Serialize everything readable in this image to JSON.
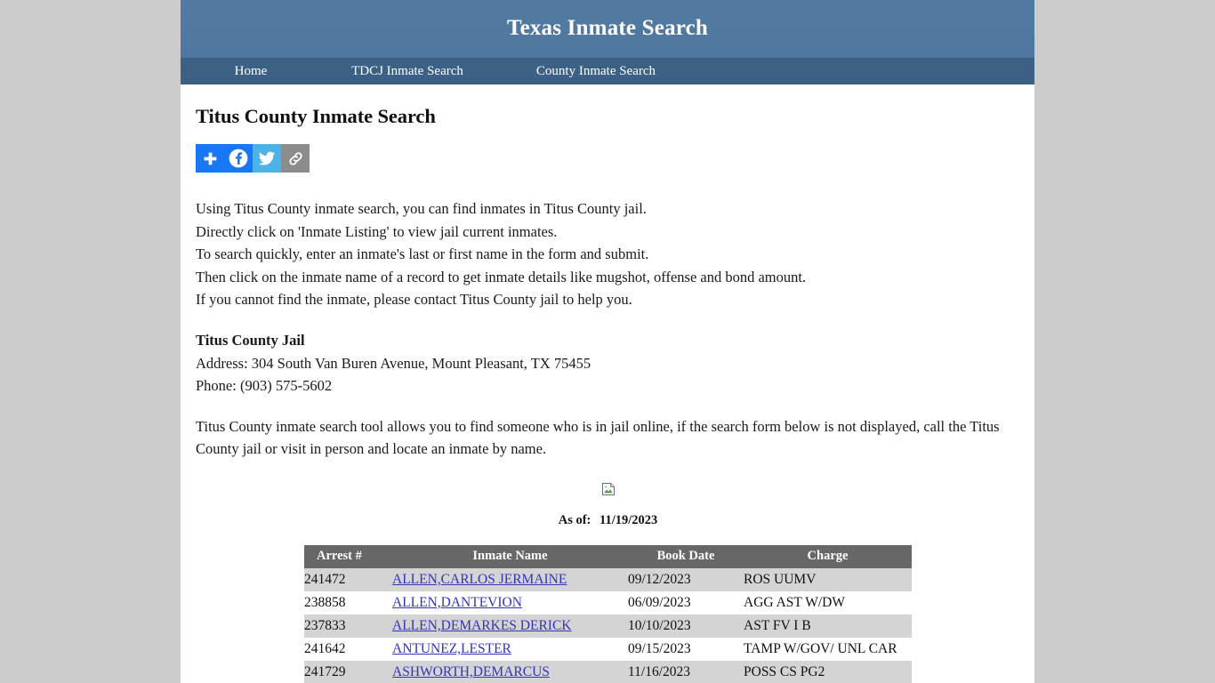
{
  "site": {
    "title": "Texas Inmate Search",
    "nav": [
      {
        "label": "Home"
      },
      {
        "label": "TDCJ Inmate Search"
      },
      {
        "label": "County Inmate Search"
      }
    ]
  },
  "page": {
    "title": "Titus County Inmate Search"
  },
  "share": {
    "buttons": [
      {
        "name": "addthis-share-icon",
        "label": "Share"
      },
      {
        "name": "facebook-icon",
        "label": "Facebook"
      },
      {
        "name": "twitter-icon",
        "label": "Twitter"
      },
      {
        "name": "copy-link-icon",
        "label": "Copy Link"
      }
    ]
  },
  "intro": {
    "lines": [
      "Using Titus County inmate search, you can find inmates in Titus County jail.",
      "Directly click on 'Inmate Listing' to view jail current inmates.",
      "To search quickly, enter an inmate's last or first name in the form and submit.",
      "Then click on the inmate name of a record to get inmate details like mugshot, offense and bond amount.",
      "If you cannot find the inmate, please contact Titus County jail to help you."
    ]
  },
  "jail": {
    "name": "Titus County Jail",
    "address": "Address: 304 South Van Buren Avenue, Mount Pleasant, TX 75455",
    "phone": "Phone: (903) 575-5602"
  },
  "tool_note": "Titus County inmate search tool allows you to find someone who is in jail online, if the search form below is not displayed, call the Titus County jail or visit in person and locate an inmate by name.",
  "as_of": {
    "label": "As of:",
    "date": "11/19/2023"
  },
  "table": {
    "columns": [
      "Arrest #",
      "Inmate Name",
      "Book Date",
      "Charge"
    ],
    "rows": [
      {
        "arrest": "241472",
        "name": "ALLEN,CARLOS JERMAINE",
        "date": "09/12/2023",
        "charge": "ROS UUMV"
      },
      {
        "arrest": "238858",
        "name": "ALLEN,DANTEVION",
        "date": "06/09/2023",
        "charge": "AGG AST W/DW"
      },
      {
        "arrest": "237833",
        "name": "ALLEN,DEMARKES DERICK",
        "date": "10/10/2023",
        "charge": "AST FV I B"
      },
      {
        "arrest": "241642",
        "name": "ANTUNEZ,LESTER",
        "date": "09/15/2023",
        "charge": "TAMP W/GOV/ UNL CAR"
      },
      {
        "arrest": "241729",
        "name": "ASHWORTH,DEMARCUS",
        "date": "11/16/2023",
        "charge": "POSS CS PG2"
      }
    ]
  },
  "colors": {
    "header_blue": "#527a9e",
    "nav_blue": "#3c6185",
    "page_background": "#cccccc",
    "table_header_gray": "#676767",
    "row_gray": "#d4d4d4",
    "link_blue": "#3333bb"
  }
}
